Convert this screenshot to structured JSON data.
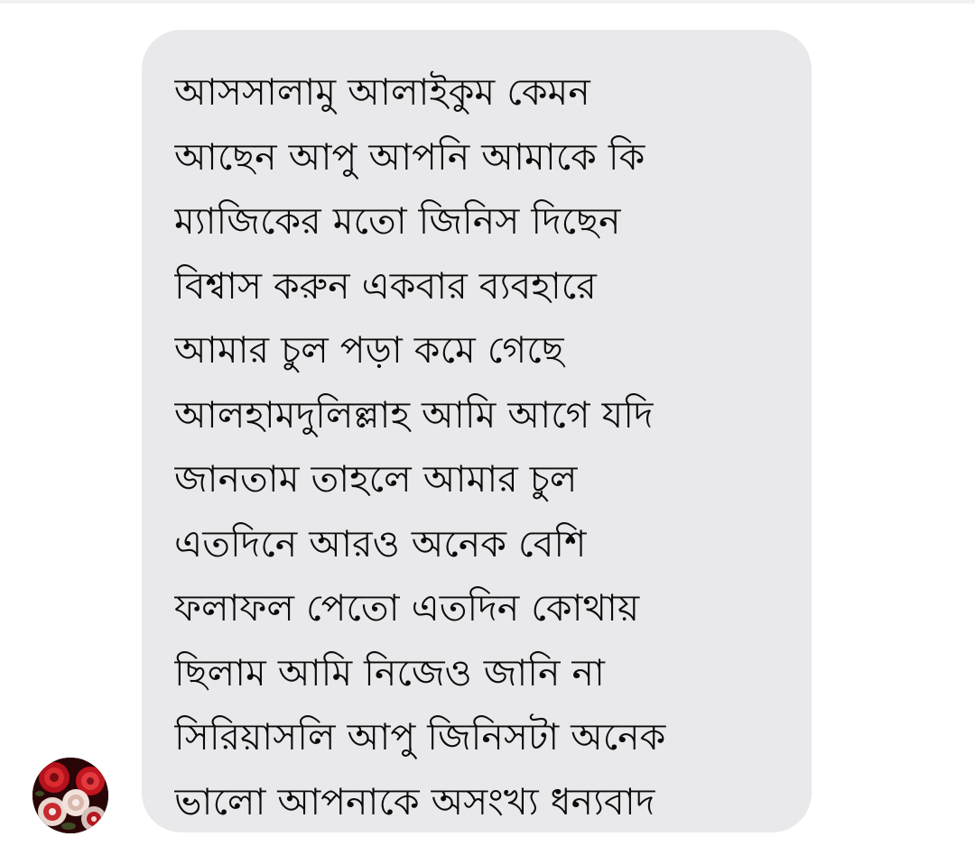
{
  "conversation": {
    "incoming_message": {
      "sender_avatar_icon": "rose-avatar-icon",
      "bubble_color": "#e9e9eb",
      "text_color": "#0b0b0b",
      "lines": [
        "আসসালামু আলাইকুম কেমন",
        "আছেন আপু আপনি আমাকে কি",
        "ম্যাজিকের মতো জিনিস দিছেন",
        "বিশ্বাস করুন একবার ব্যবহারে",
        "আমার চুল পড়া কমে গেছে",
        "আলহামদুলিল্লাহ আমি আগে যদি",
        "জানতাম তাহলে আমার চুল",
        "এতদিনে আরও অনেক বেশি",
        "ফলাফল পেতো এতদিন কোথায়",
        "ছিলাম আমি নিজেও জানি না",
        "সিরিয়াসলি আপু জিনিসটা অনেক",
        "ভালো আপনাকে অসংখ্য ধন্যবাদ"
      ]
    }
  }
}
